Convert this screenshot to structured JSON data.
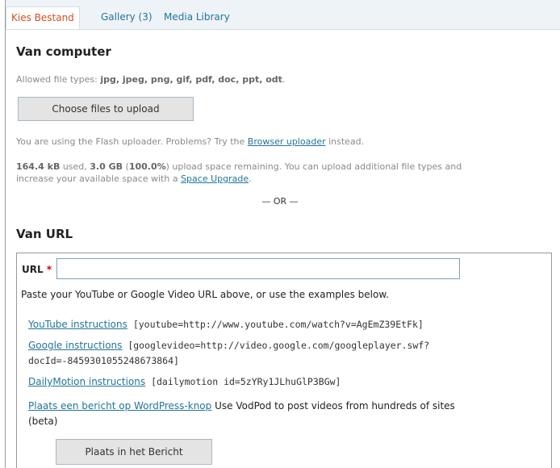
{
  "tabs": [
    {
      "label": "Kies Bestand"
    },
    {
      "label": "Gallery (3)"
    },
    {
      "label": "Media Library"
    }
  ],
  "computer": {
    "heading": "Van computer",
    "allowed_prefix": "Allowed file types: ",
    "allowed_types": "jpg, jpeg, png, gif, pdf, doc, ppt, odt",
    "allowed_suffix": ".",
    "choose_button": "Choose files to upload",
    "flash_text": "You are using the Flash uploader. Problems? Try the ",
    "flash_link": "Browser uploader",
    "flash_suffix": " instead.",
    "used_value": "164.4 kB",
    "used_text": " used, ",
    "remaining_value": "3.0 GB",
    "remaining_paren_open": " (",
    "remaining_percent": "100.0%",
    "remaining_text": ") upload space remaining. You can upload additional file types and",
    "space_line2": "increase your available space with a ",
    "space_link": "Space Upgrade",
    "space_suffix": "."
  },
  "or_label": "— OR —",
  "url": {
    "heading": "Van URL",
    "label": "URL",
    "required": "*",
    "value": "",
    "hint": "Paste your YouTube or Google Video URL above, or use the examples below.",
    "examples": [
      {
        "link": "YouTube instructions",
        "code": " [youtube=http://www.youtube.com/watch?v=AgEmZ39EtFk]"
      },
      {
        "link": "Google instructions",
        "code": " [googlevideo=http://video.google.com/googleplayer.swf?",
        "code2": "docId=-8459301055248673864]"
      },
      {
        "link": "DailyMotion instructions",
        "code": " [dailymotion id=5zYRy1JLhuGlP3BGw]"
      },
      {
        "link": "Plaats een bericht op WordPress-knop",
        "text": " Use VodPod to post videos from hundreds of sites",
        "text2": "(beta)"
      }
    ],
    "insert_button": "Plaats in het Bericht"
  }
}
